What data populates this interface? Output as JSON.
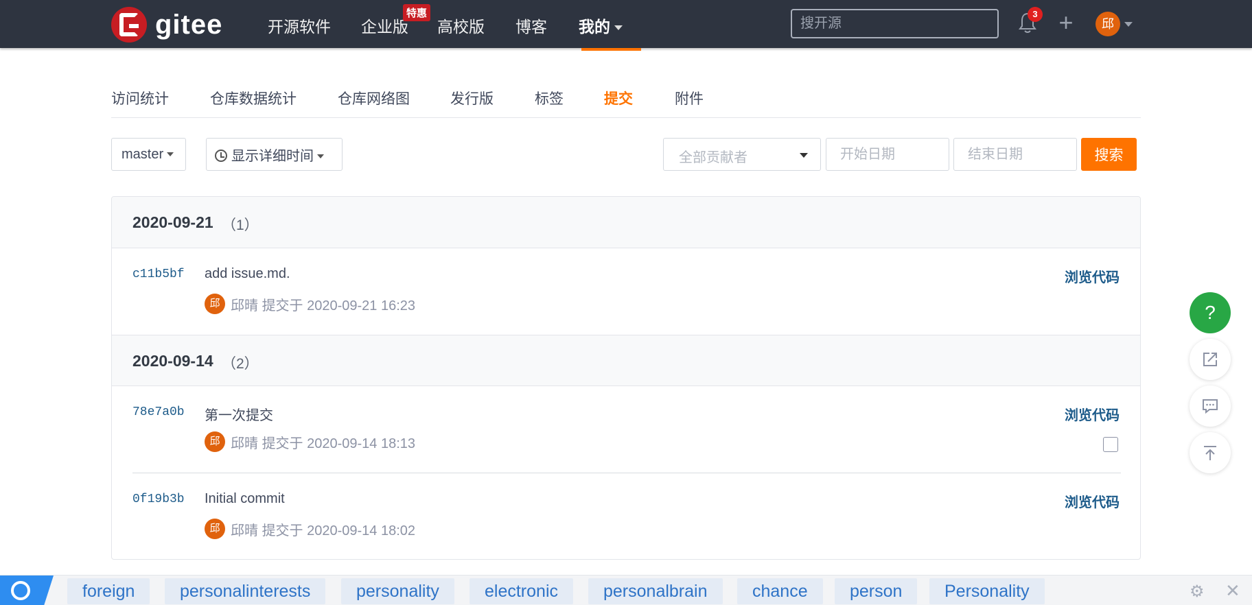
{
  "header": {
    "logo_text": "gitee",
    "nav": [
      "开源软件",
      "企业版",
      "高校版",
      "博客",
      "我的"
    ],
    "special_badge": "特惠",
    "search_placeholder": "搜开源",
    "notif_count": "3",
    "avatar_char": "邱"
  },
  "subtabs": [
    "访问统计",
    "仓库数据统计",
    "仓库网络图",
    "发行版",
    "标签",
    "提交",
    "附件"
  ],
  "active_subtab": "提交",
  "filters": {
    "branch": "master",
    "time_toggle": "显示详细时间",
    "contributor_placeholder": "全部贡献者",
    "start_date_placeholder": "开始日期",
    "end_date_placeholder": "结束日期",
    "search_button": "搜索"
  },
  "groups": [
    {
      "date": "2020-09-21",
      "count": "（1）",
      "commits": [
        {
          "sha": "c11b5bf",
          "message": "add issue.md.",
          "author": "邱晴",
          "meta": "提交于 2020-09-21 16:23",
          "browse": "浏览代码",
          "avatar": "邱"
        }
      ]
    },
    {
      "date": "2020-09-14",
      "count": "（2）",
      "commits": [
        {
          "sha": "78e7a0b",
          "message": "第一次提交",
          "author": "邱晴",
          "meta": "提交于 2020-09-14 18:13",
          "browse": "浏览代码",
          "avatar": "邱"
        },
        {
          "sha": "0f19b3b",
          "message": "Initial commit",
          "author": "邱晴",
          "meta": "提交于 2020-09-14 18:02",
          "browse": "浏览代码",
          "avatar": "邱"
        }
      ]
    }
  ],
  "fab": {
    "help": "?"
  },
  "bottom_tags": [
    "foreign",
    "personalinterests",
    "personality",
    "electronic",
    "personalbrain",
    "chance",
    "person",
    "Personality"
  ],
  "colors": {
    "accent": "#fe7300",
    "nav_bg": "#2e3440",
    "link": "#1d5b8a",
    "help_green": "#28a745"
  }
}
